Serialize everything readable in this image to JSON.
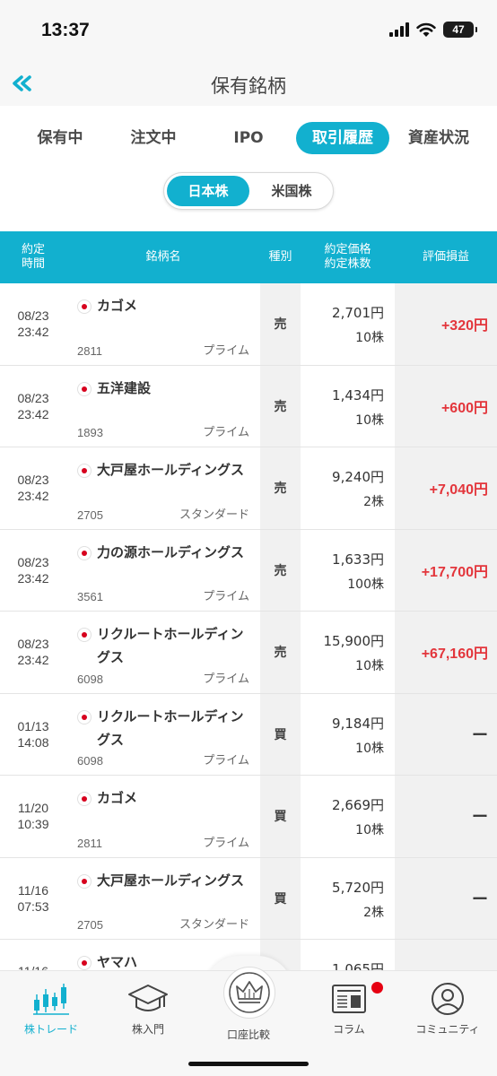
{
  "status_bar": {
    "time": "13:37",
    "battery": "47"
  },
  "header": {
    "title": "保有銘柄",
    "back_icon": "double-chevron-left-icon"
  },
  "tabs": [
    {
      "label": "保有中",
      "active": false
    },
    {
      "label": "注文中",
      "active": false
    },
    {
      "label": "IPO",
      "active": false
    },
    {
      "label": "取引履歴",
      "active": true
    },
    {
      "label": "資産状況",
      "active": false
    }
  ],
  "market_toggle": {
    "japan": "日本株",
    "us": "米国株",
    "selected": "日本株"
  },
  "table_head": {
    "date_line1": "約定",
    "date_line2": "時間",
    "name": "銘柄名",
    "type": "種別",
    "price_line1": "約定価格",
    "price_line2": "約定株数",
    "pl": "評価損益"
  },
  "rows": [
    {
      "date": "08/23",
      "time": "23:42",
      "name": "カゴメ",
      "code": "2811",
      "market": "プライム",
      "type": "売",
      "price": "2,701円",
      "qty": "10株",
      "pl": "+320円"
    },
    {
      "date": "08/23",
      "time": "23:42",
      "name": "五洋建設",
      "code": "1893",
      "market": "プライム",
      "type": "売",
      "price": "1,434円",
      "qty": "10株",
      "pl": "+600円"
    },
    {
      "date": "08/23",
      "time": "23:42",
      "name": "大戸屋ホールディングス",
      "code": "2705",
      "market": "スタンダード",
      "type": "売",
      "price": "9,240円",
      "qty": "2株",
      "pl": "+7,040円"
    },
    {
      "date": "08/23",
      "time": "23:42",
      "name": "力の源ホールディングス",
      "code": "3561",
      "market": "プライム",
      "type": "売",
      "price": "1,633円",
      "qty": "100株",
      "pl": "+17,700円"
    },
    {
      "date": "08/23",
      "time": "23:42",
      "name": "リクルートホールディングス",
      "code": "6098",
      "market": "プライム",
      "type": "売",
      "price": "15,900円",
      "qty": "10株",
      "pl": "+67,160円"
    },
    {
      "date": "01/13",
      "time": "14:08",
      "name": "リクルートホールディングス",
      "code": "6098",
      "market": "プライム",
      "type": "買",
      "price": "9,184円",
      "qty": "10株",
      "pl": "ー"
    },
    {
      "date": "11/20",
      "time": "10:39",
      "name": "カゴメ",
      "code": "2811",
      "market": "プライム",
      "type": "買",
      "price": "2,669円",
      "qty": "10株",
      "pl": "ー"
    },
    {
      "date": "11/16",
      "time": "07:53",
      "name": "大戸屋ホールディングス",
      "code": "2705",
      "market": "スタンダード",
      "type": "買",
      "price": "5,720円",
      "qty": "2株",
      "pl": "ー"
    },
    {
      "date": "11/16",
      "time": "",
      "name": "ヤマハ",
      "code": "",
      "market": "",
      "type": "",
      "price": "1,065円",
      "qty": "",
      "pl": ""
    }
  ],
  "bottom_nav": [
    {
      "label": "株トレード",
      "icon": "candlestick-chart-icon",
      "active": true
    },
    {
      "label": "株入門",
      "icon": "graduation-cap-icon",
      "active": false
    },
    {
      "label": "口座比較",
      "icon": "crown-icon",
      "active": false
    },
    {
      "label": "コラム",
      "icon": "newspaper-icon",
      "active": false,
      "badge": true
    },
    {
      "label": "コミュニティ",
      "icon": "user-circle-icon",
      "active": false
    }
  ],
  "colors": {
    "accent": "#12b0cf",
    "gain": "#e3363c",
    "flag_red": "#d7001d"
  }
}
